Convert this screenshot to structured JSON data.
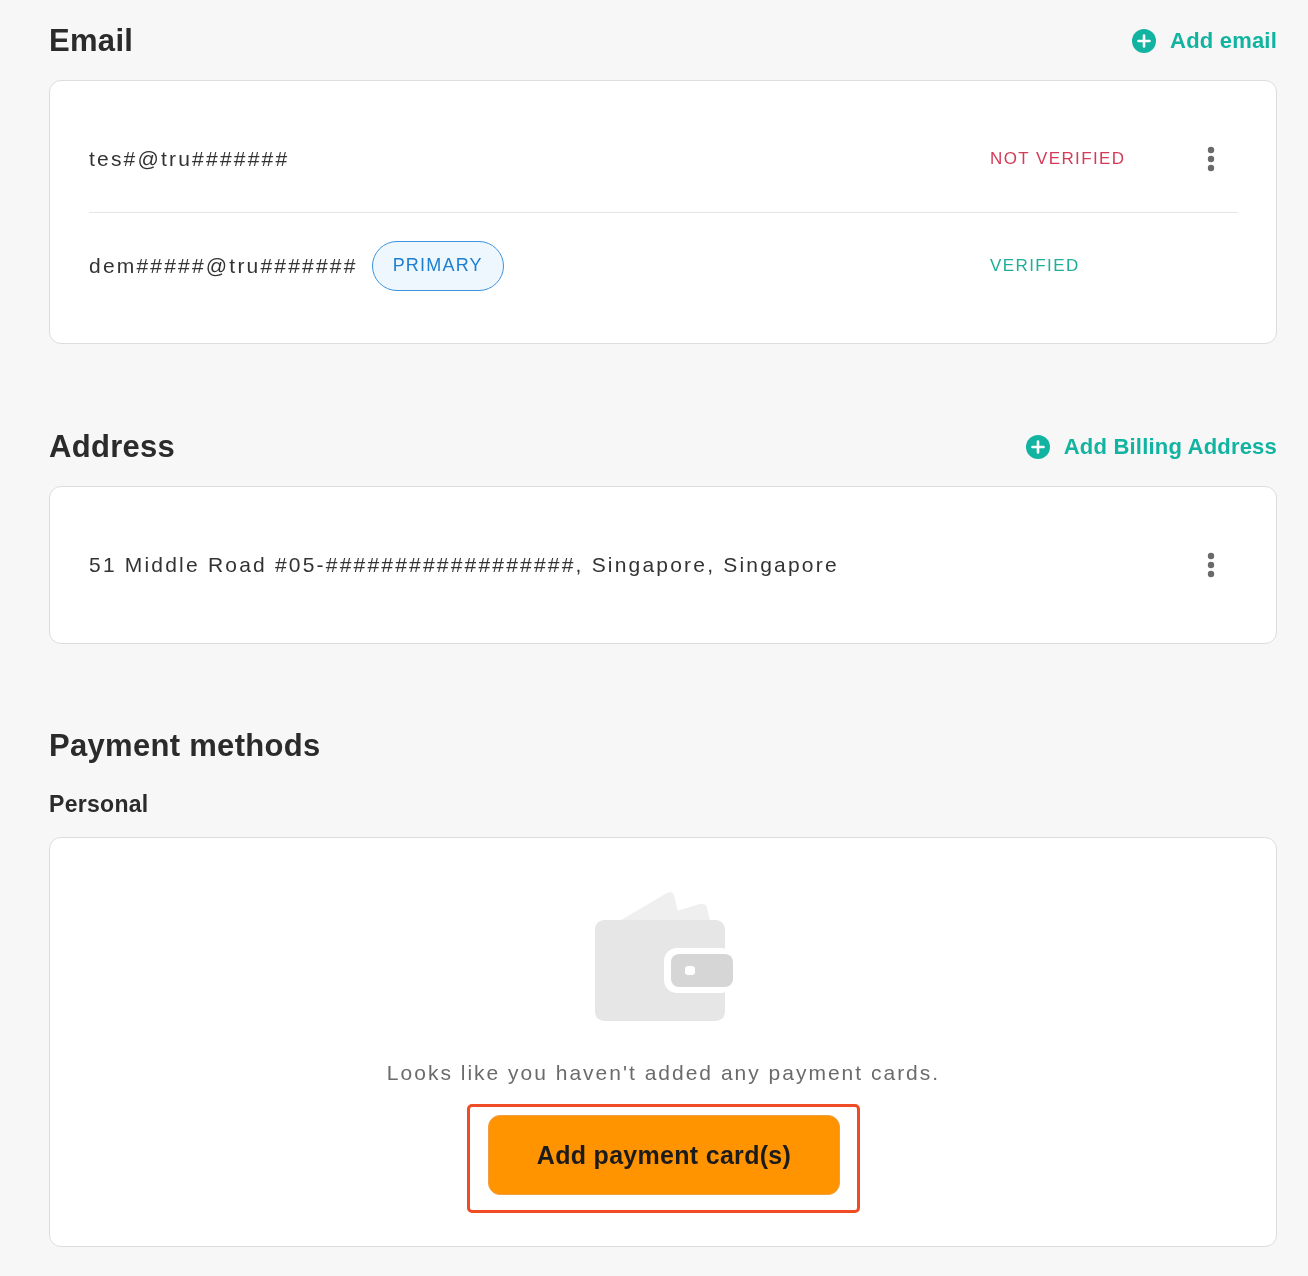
{
  "email": {
    "title": "Email",
    "add_action": {
      "label": "Add email"
    },
    "rows": [
      {
        "address": "tes#@tru#######",
        "verified": false,
        "status": "NOT VERIFIED",
        "has_menu": true
      },
      {
        "address": "dem#####@tru#######",
        "badge": "PRIMARY",
        "verified": true,
        "status": "VERIFIED",
        "has_menu": false
      }
    ]
  },
  "address": {
    "title": "Address",
    "add_action": {
      "label": "Add Billing Address"
    },
    "items": [
      {
        "text": "51 Middle Road #05-##################, Singapore, Singapore",
        "has_menu": true
      }
    ]
  },
  "payment_methods": {
    "title": "Payment methods",
    "groups": [
      {
        "title": "Personal",
        "empty_message": "Looks like you haven't added any payment cards.",
        "button": {
          "label": "Add payment card(s)",
          "highlighted": true
        }
      }
    ]
  }
}
